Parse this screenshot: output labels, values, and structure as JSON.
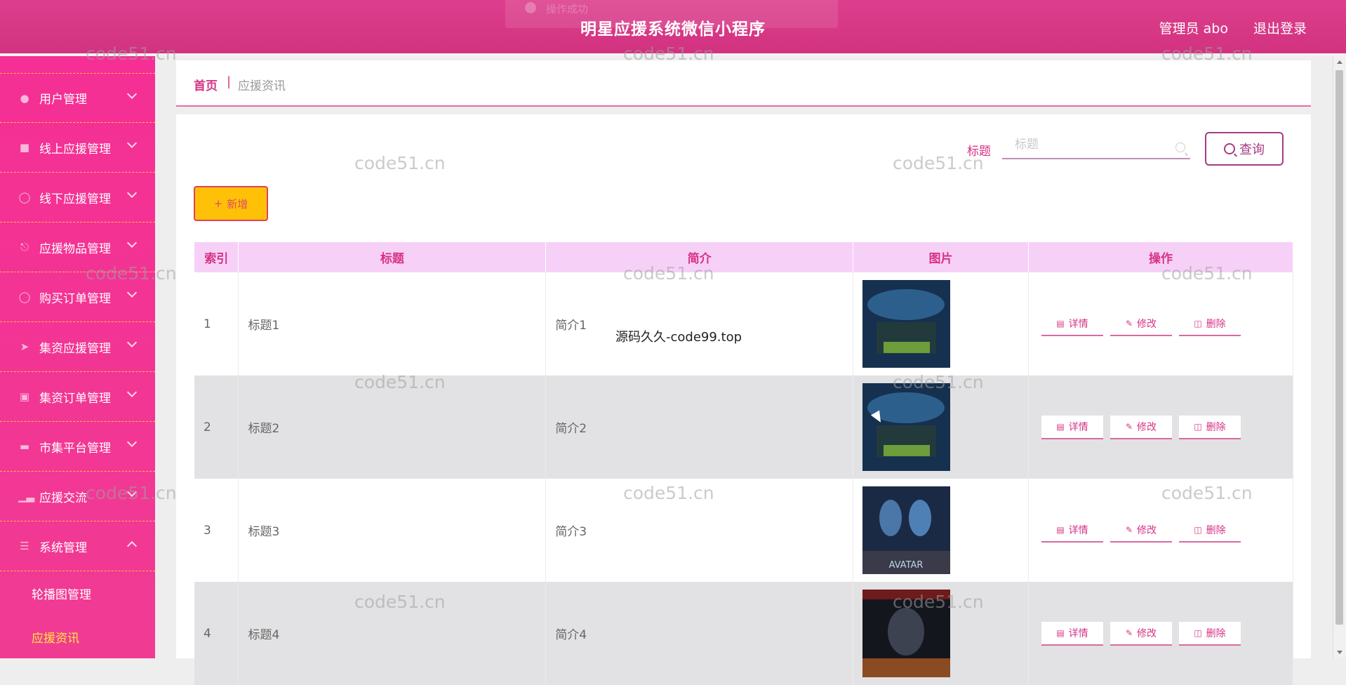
{
  "header": {
    "title": "明星应援系统微信小程序",
    "toast": "操作成功",
    "admin_label": "管理员 abo",
    "logout_label": "退出登录"
  },
  "sidebar": {
    "items": [
      {
        "label": "用户管理",
        "icon": "user-icon"
      },
      {
        "label": "线上应援管理",
        "icon": "clipboard-icon"
      },
      {
        "label": "线下应援管理",
        "icon": "compass-icon"
      },
      {
        "label": "应援物品管理",
        "icon": "microphone-icon"
      },
      {
        "label": "购买订单管理",
        "icon": "order-icon"
      },
      {
        "label": "集资应援管理",
        "icon": "send-icon"
      },
      {
        "label": "集资订单管理",
        "icon": "chart-box-icon"
      },
      {
        "label": "市集平台管理",
        "icon": "ticket-icon"
      },
      {
        "label": "应援交流",
        "icon": "bar-chart-icon"
      },
      {
        "label": "系统管理",
        "icon": "menu-icon"
      }
    ],
    "sub_items": [
      {
        "label": "轮播图管理"
      },
      {
        "label": "应援资讯"
      }
    ],
    "active_color": "#ffeb3b"
  },
  "breadcrumb": {
    "home": "首页",
    "separator": "|",
    "current": "应援资讯"
  },
  "search": {
    "label": "标题",
    "placeholder": "标题",
    "button": "查询"
  },
  "add_button": "新增",
  "table": {
    "columns": [
      "索引",
      "标题",
      "简介",
      "图片",
      "操作"
    ],
    "rows": [
      {
        "index": "1",
        "title": "标题1",
        "intro": "简介1",
        "poster": "dark-poster"
      },
      {
        "index": "2",
        "title": "标题2",
        "intro": "简介2",
        "poster": "dark-poster"
      },
      {
        "index": "3",
        "title": "标题3",
        "intro": "简介3",
        "poster": "avatar-poster",
        "poster_text": "AVATAR"
      },
      {
        "index": "4",
        "title": "标题4",
        "intro": "简介4",
        "poster": "action-poster"
      }
    ],
    "actions": {
      "detail": "详情",
      "edit": "修改",
      "delete": "删除"
    }
  },
  "watermark": "code51.cn",
  "overlay_text": "源码久久-code99.top",
  "colors": {
    "header": "#d63384",
    "sidebar": "#f42f94",
    "accent": "#d63384",
    "table_header": "#f7d0f7",
    "add_button": "#ffc107"
  }
}
